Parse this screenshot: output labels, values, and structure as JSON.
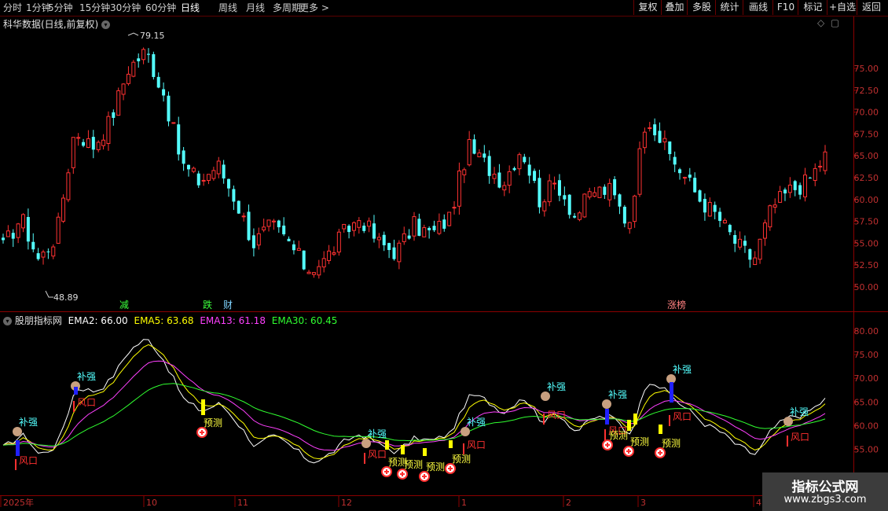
{
  "toolbar": {
    "periods": [
      "分时",
      "1分钟",
      "5分钟",
      "15分钟",
      "30分钟",
      "60分钟",
      "日线",
      "周线",
      "月线",
      "多周期",
      "更多 >"
    ],
    "active_period": "日线",
    "right_buttons": [
      "复权",
      "叠加",
      "多股",
      "统计",
      "画线",
      "F10",
      "标记",
      "+自选",
      "返回"
    ]
  },
  "upper_panel": {
    "title": "科华数据(日线,前复权)",
    "high_label": "79.15",
    "low_label": "48.89",
    "event_markers": [
      "减",
      "跌",
      "财",
      "涨榜"
    ]
  },
  "lower_panel": {
    "indicator_name": "股朋指标网",
    "ema": [
      {
        "label": "EMA2: 66.00",
        "color": "#ffffff"
      },
      {
        "label": "EMA5: 63.68",
        "color": "#ffff00"
      },
      {
        "label": "EMA13: 61.18",
        "color": "#ff40ff"
      },
      {
        "label": "EMA30: 60.45",
        "color": "#30ff30"
      }
    ],
    "signal_labels": {
      "strong": "补强",
      "window": "风口",
      "detect": "预测"
    }
  },
  "x_axis": {
    "labels": [
      "2025年",
      "10",
      "11",
      "12",
      "1",
      "2",
      "3",
      "4"
    ]
  },
  "watermark": {
    "title": "指标公式网",
    "url": "www.zbgs3.com"
  },
  "colors": {
    "up": "#ff3232",
    "down": "#54ffff",
    "grid": "#8b0000"
  },
  "chart_data": [
    {
      "type": "candlestick",
      "title": "科华数据(日线,前复权)",
      "y_ticks": [
        50.0,
        52.5,
        55.0,
        57.5,
        60.0,
        62.5,
        65.0,
        67.5,
        70.0,
        72.5,
        75.0
      ],
      "ylim": [
        48.5,
        79.5
      ],
      "annotated_high": 79.15,
      "annotated_low": 48.89,
      "x_labels": [
        "2025年",
        "10",
        "11",
        "12",
        "1",
        "2",
        "3",
        "4"
      ],
      "approx_close_path": [
        54.5,
        58,
        53,
        56,
        68,
        66,
        69,
        75,
        77,
        72,
        64,
        62,
        64,
        60,
        55,
        57,
        55,
        52,
        53,
        56,
        58,
        55,
        54,
        57,
        56,
        58,
        66,
        64,
        62,
        66,
        60,
        62,
        58,
        61,
        61,
        57,
        70,
        66,
        63,
        60,
        58,
        55,
        53,
        59,
        61,
        62,
        65
      ]
    },
    {
      "type": "line",
      "title": "股朋指标网",
      "y_ticks": [
        55.0,
        60.0,
        65.0,
        70.0,
        75.0,
        80.0
      ],
      "ylim": [
        50.5,
        82
      ],
      "series": [
        {
          "name": "EMA2",
          "last": 66.0
        },
        {
          "name": "EMA5",
          "last": 63.68
        },
        {
          "name": "EMA13",
          "last": 61.18
        },
        {
          "name": "EMA30",
          "last": 60.45
        }
      ]
    }
  ]
}
